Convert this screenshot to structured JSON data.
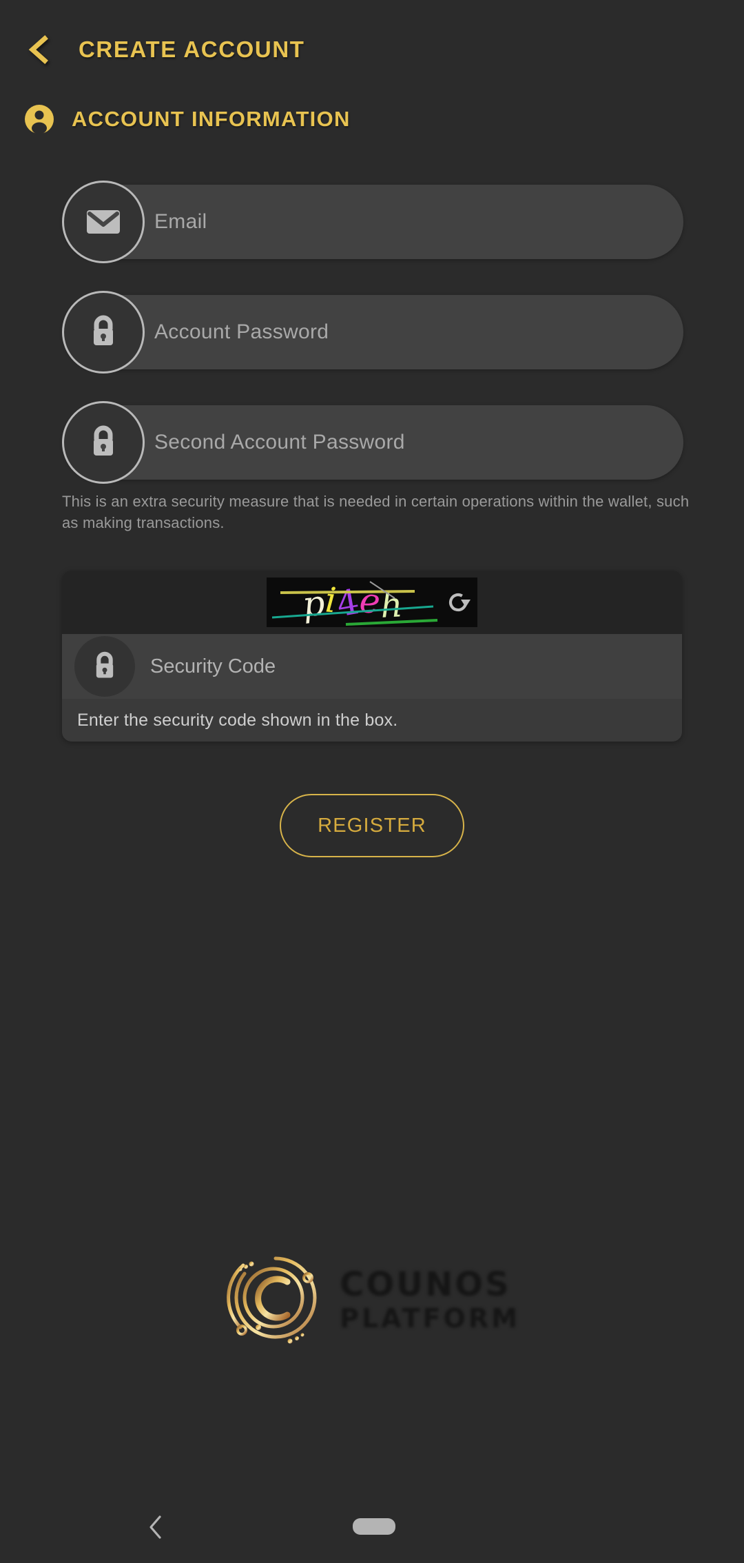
{
  "theme": {
    "background": "#2b2b2b",
    "accent_gold": "#e8c351",
    "field_background": "#424242",
    "placeholder_color": "#a9a9a9"
  },
  "header": {
    "back_icon": "chevron-left-icon",
    "title": "CREATE ACCOUNT"
  },
  "section": {
    "icon": "person-icon",
    "title": "ACCOUNT INFORMATION"
  },
  "fields": [
    {
      "icon": "mail-icon",
      "placeholder": "Email",
      "value": ""
    },
    {
      "icon": "lock-icon",
      "placeholder": "Account Password",
      "value": ""
    },
    {
      "icon": "lock-icon",
      "placeholder": "Second Account Password",
      "value": ""
    }
  ],
  "helper_text": "This is an extra security measure that is needed in certain operations within the wallet, such as making transactions.",
  "captcha": {
    "code": "pi4eh",
    "characters": [
      {
        "char": "p",
        "color": "#f2f0d8"
      },
      {
        "char": "i",
        "color": "#f0e63c"
      },
      {
        "char": "4",
        "color": "#a63fe8"
      },
      {
        "char": "e",
        "color": "#f03cb4"
      },
      {
        "char": "h",
        "color": "#dff0b0"
      }
    ],
    "refresh_icon": "refresh-icon",
    "input": {
      "icon": "lock-icon",
      "placeholder": "Security Code",
      "value": ""
    },
    "hint": "Enter the security code shown in the box."
  },
  "register_button": {
    "label": "REGISTER"
  },
  "logo": {
    "mark": "counos-logo-mark",
    "line1": "COUNOS",
    "line2": "PLATFORM"
  },
  "navbar": {
    "back_icon": "nav-back-icon",
    "home_indicator": "home-pill-indicator"
  }
}
